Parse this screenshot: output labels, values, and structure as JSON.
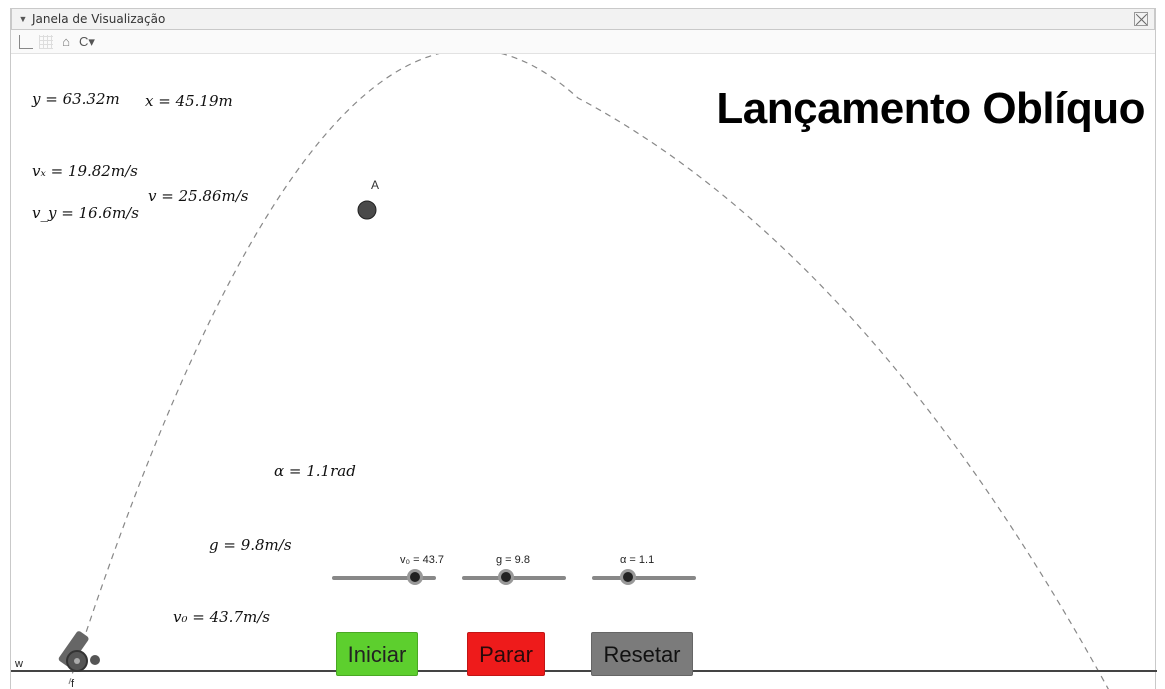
{
  "window": {
    "title": "Janela de Visualização"
  },
  "toolbar": {
    "icons": [
      "axes-icon",
      "grid-icon",
      "home-icon",
      "style-icon"
    ]
  },
  "heading": "Lançamento Oblíquo",
  "readouts": {
    "y": "y = 63.32m",
    "x": "x = 45.19m",
    "vx": "vₓ = 19.82m/s",
    "v": "v = 25.86m/s",
    "vy": "v_y = 16.6m/s",
    "alpha": "α = 1.1rad",
    "g": "g = 9.8m/s",
    "v0": "v₀ = 43.7m/s"
  },
  "point_label": "A",
  "axis_labels": {
    "w": "w",
    "f": "f"
  },
  "sliders": {
    "v0": {
      "caption": "v₀ = 43.7",
      "value": 43.7,
      "fraction": 0.8
    },
    "g": {
      "caption": "g = 9.8",
      "value": 9.8,
      "fraction": 0.42
    },
    "alpha": {
      "caption": "α = 1.1",
      "value": 1.1,
      "fraction": 0.35
    }
  },
  "buttons": {
    "iniciar": "Iniciar",
    "parar": "Parar",
    "resetar": "Resetar"
  },
  "colors": {
    "iniciar": "#5dcf2e",
    "parar": "#ee1b1b",
    "resetar": "#7b7b7b"
  }
}
